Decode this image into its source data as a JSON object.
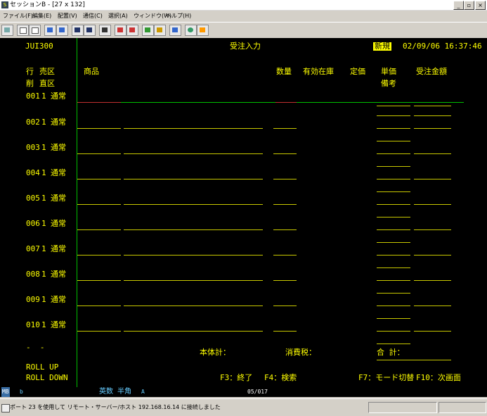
{
  "window": {
    "title": "セッションB - [27 x 132]",
    "controls": [
      "_",
      "▫",
      "×"
    ]
  },
  "menu": [
    "ファイル(F)",
    "編集(E)",
    "配置(V)",
    "通信(C)",
    "選択(A)",
    "ウィンドウ(W)",
    "ヘルプ(H)"
  ],
  "toolbar": {
    "icons": [
      "print-screen-icon",
      "copy-icon",
      "paste-icon",
      "send-icon",
      "receive-icon",
      "display-icon",
      "keypad-icon",
      "macro-icon",
      "record-icon",
      "stop-icon",
      "play-icon",
      "color-icon",
      "help-icon",
      "edit-icon"
    ]
  },
  "screen": {
    "program_id": "JUI300",
    "screen_title": "受注入力",
    "mode_badge": "新規",
    "datetime": "02/09/06 16:37:46",
    "headers": {
      "row_label": "行",
      "delete_label": "削",
      "sales_class": "売区",
      "direct_class": "直区",
      "product": "商品",
      "quantity": "数量",
      "stock": "有効在庫",
      "list_price": "定価",
      "unit_price": "単価",
      "remarks": "備考",
      "order_amount": "受注金額"
    },
    "rows": [
      {
        "no": "001",
        "code": "1",
        "kind": "通常"
      },
      {
        "no": "002",
        "code": "1",
        "kind": "通常"
      },
      {
        "no": "003",
        "code": "1",
        "kind": "通常"
      },
      {
        "no": "004",
        "code": "1",
        "kind": "通常"
      },
      {
        "no": "005",
        "code": "1",
        "kind": "通常"
      },
      {
        "no": "006",
        "code": "1",
        "kind": "通常"
      },
      {
        "no": "007",
        "code": "1",
        "kind": "通常"
      },
      {
        "no": "008",
        "code": "1",
        "kind": "通常"
      },
      {
        "no": "009",
        "code": "1",
        "kind": "通常"
      },
      {
        "no": "010",
        "code": "1",
        "kind": "通常"
      }
    ],
    "dashes": "-  -",
    "totals": {
      "subtotal_label": "本体計：",
      "tax_label": "消費税：",
      "total_label": "合 計："
    },
    "roll_up": "ROLL UP",
    "roll_down": "ROLL DOWN",
    "fkeys": {
      "f3": "F3：終了",
      "f4": "F4：検索",
      "f7": "F7：モード切替",
      "f10": "F10：次画面"
    }
  },
  "oia": {
    "indicator": "MB",
    "session": "b",
    "input_mode": "英数 半角",
    "a": "A",
    "cursor_pos": "05/017"
  },
  "statusbar": {
    "message": "ポート 23 を使用して リモート・サーバー/ホスト 192.168.16.14 に接続しました"
  }
}
